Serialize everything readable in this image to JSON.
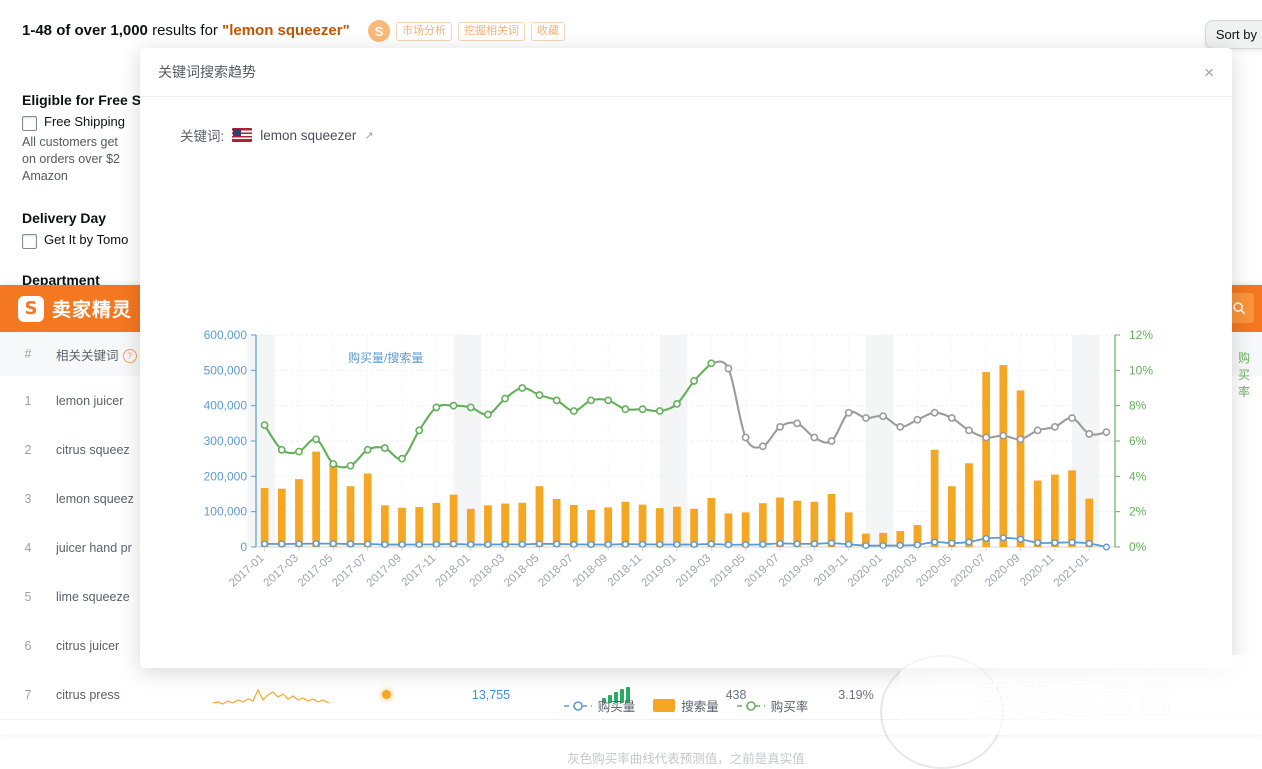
{
  "background": {
    "results_prefix": "1-48 of over 1,000",
    "results_mid": " results for ",
    "results_keyword": "\"lemon squeezer\"",
    "sort_by": "Sort by",
    "sg_badge": "S",
    "chips": [
      "市场分析",
      "挖掘相关词",
      "收藏"
    ],
    "facets": [
      {
        "heading": "Eligible for Free S",
        "checkbox": "Free Shipping",
        "note": "All customers get\non orders over $2\nAmazon"
      },
      {
        "heading": "Delivery Day",
        "checkbox": "Get It by Tomo",
        "note": ""
      },
      {
        "heading": "Department",
        "checkbox": "",
        "note": ""
      }
    ]
  },
  "sellersprite": {
    "brand_mark": "S",
    "brand_name": "卖家精灵",
    "search_icon": "search-icon",
    "columns": {
      "index": "#",
      "keyword": "相关关键词"
    },
    "rows": [
      {
        "idx": "1",
        "keyword": "lemon juicer"
      },
      {
        "idx": "2",
        "keyword": "citrus squeez"
      },
      {
        "idx": "3",
        "keyword": "lemon squeez"
      },
      {
        "idx": "4",
        "keyword": "juicer hand pr"
      },
      {
        "idx": "5",
        "keyword": "lime squeeze"
      },
      {
        "idx": "6",
        "keyword": "citrus juicer"
      },
      {
        "idx": "7",
        "keyword": "citrus press",
        "search_volume": "13,755",
        "orders": "438",
        "rate": "3.19%"
      }
    ]
  },
  "modal": {
    "title": "关键词搜索趋势",
    "close_icon": "×",
    "keyword_label": "关键词:",
    "keyword_value": "lemon squeezer",
    "country_flag": "us-flag-icon",
    "external_icon": "↗",
    "legend": [
      {
        "name": "购买量",
        "type": "line",
        "color": "#5b9bd5"
      },
      {
        "name": "搜索量",
        "type": "bar",
        "color": "#f5a623"
      },
      {
        "name": "购买率",
        "type": "line",
        "color": "#64b05a"
      }
    ],
    "footnote": "灰色购买率曲线代表预测值，之前是真实值"
  },
  "watermark": "电商运营官",
  "chart_data": {
    "type": "bar",
    "title": "关键词搜索趋势",
    "xlabel": "",
    "ylabel": "购买量/搜索量",
    "y2label": "购买率",
    "ylim": [
      0,
      600000
    ],
    "y2lim": [
      0,
      12
    ],
    "yticks": [
      "0",
      "100,000",
      "200,000",
      "300,000",
      "400,000",
      "500,000",
      "600,000"
    ],
    "y2ticks": [
      "0%",
      "2%",
      "4%",
      "6%",
      "8%",
      "10%",
      "12%"
    ],
    "grid": true,
    "legend_position": "bottom",
    "xtick_labels": [
      "2017-01",
      "2017-03",
      "2017-05",
      "2017-07",
      "2017-09",
      "2017-11",
      "2018-01",
      "2018-03",
      "2018-05",
      "2018-07",
      "2018-09",
      "2018-11",
      "2019-01",
      "2019-03",
      "2019-05",
      "2019-07",
      "2019-09",
      "2019-11",
      "2020-01",
      "2020-03",
      "2020-05",
      "2020-07",
      "2020-09",
      "2020-11",
      "2021-01"
    ],
    "x": [
      "2017-01",
      "2017-02",
      "2017-03",
      "2017-04",
      "2017-05",
      "2017-06",
      "2017-07",
      "2017-08",
      "2017-09",
      "2017-10",
      "2017-11",
      "2017-12",
      "2018-01",
      "2018-02",
      "2018-03",
      "2018-04",
      "2018-05",
      "2018-06",
      "2018-07",
      "2018-08",
      "2018-09",
      "2018-10",
      "2018-11",
      "2018-12",
      "2019-01",
      "2019-02",
      "2019-03",
      "2019-04",
      "2019-05",
      "2019-06",
      "2019-07",
      "2019-08",
      "2019-09",
      "2019-10",
      "2019-11",
      "2019-12",
      "2020-01",
      "2020-02",
      "2020-03",
      "2020-04",
      "2020-05",
      "2020-06",
      "2020-07",
      "2020-08",
      "2020-09",
      "2020-10",
      "2020-11",
      "2020-12",
      "2021-01",
      "2021-02"
    ],
    "series": [
      {
        "name": "搜索量",
        "type": "bar",
        "color": "#f5a623",
        "values": [
          167000,
          165000,
          192000,
          270000,
          238000,
          172000,
          208000,
          118000,
          111000,
          113000,
          125000,
          148000,
          108000,
          118000,
          123000,
          125000,
          172000,
          136000,
          119000,
          105000,
          112000,
          128000,
          120000,
          110000,
          114000,
          108000,
          139000,
          95000,
          98000,
          124000,
          140000,
          131000,
          128000,
          150000,
          98000,
          38000,
          40000,
          45000,
          62000,
          275000,
          172000,
          237000,
          495000,
          515000,
          443000,
          188000,
          205000,
          217000,
          137000,
          0
        ]
      },
      {
        "name": "购买量",
        "type": "line",
        "color": "#5b9bd5",
        "values": [
          9000,
          8500,
          9000,
          9500,
          9500,
          8500,
          8500,
          7000,
          7000,
          7000,
          7500,
          8500,
          7000,
          7000,
          7500,
          7500,
          9000,
          8500,
          7500,
          7000,
          7000,
          8000,
          7500,
          7000,
          7000,
          7000,
          8500,
          6500,
          6500,
          7500,
          10000,
          9000,
          9000,
          11000,
          7500,
          4000,
          4000,
          4500,
          6000,
          14000,
          11000,
          14000,
          24000,
          26000,
          22000,
          12000,
          12000,
          13000,
          10000,
          0
        ]
      },
      {
        "name": "购买率",
        "type": "line",
        "color": "#64b05a",
        "forecast_color": "#9b9b9b",
        "forecast_starts_at": "2019-03",
        "values": [
          6.9,
          5.5,
          5.4,
          6.1,
          4.7,
          4.6,
          5.5,
          5.6,
          5.0,
          6.6,
          7.9,
          8.0,
          7.9,
          7.5,
          8.4,
          9.0,
          8.6,
          8.3,
          7.7,
          8.3,
          8.3,
          7.8,
          7.8,
          7.7,
          8.1,
          9.4,
          10.4,
          10.1,
          6.2,
          5.7,
          6.8,
          7.0,
          6.2,
          6.0,
          7.6,
          7.3,
          7.4,
          6.8,
          7.2,
          7.6,
          7.3,
          6.6,
          6.2,
          6.3,
          6.1,
          6.6,
          6.8,
          7.3,
          6.4,
          6.5
        ]
      }
    ],
    "shaded_bands": [
      "2017-01",
      "2018-01",
      "2019-01",
      "2020-01",
      "2021-01"
    ]
  }
}
